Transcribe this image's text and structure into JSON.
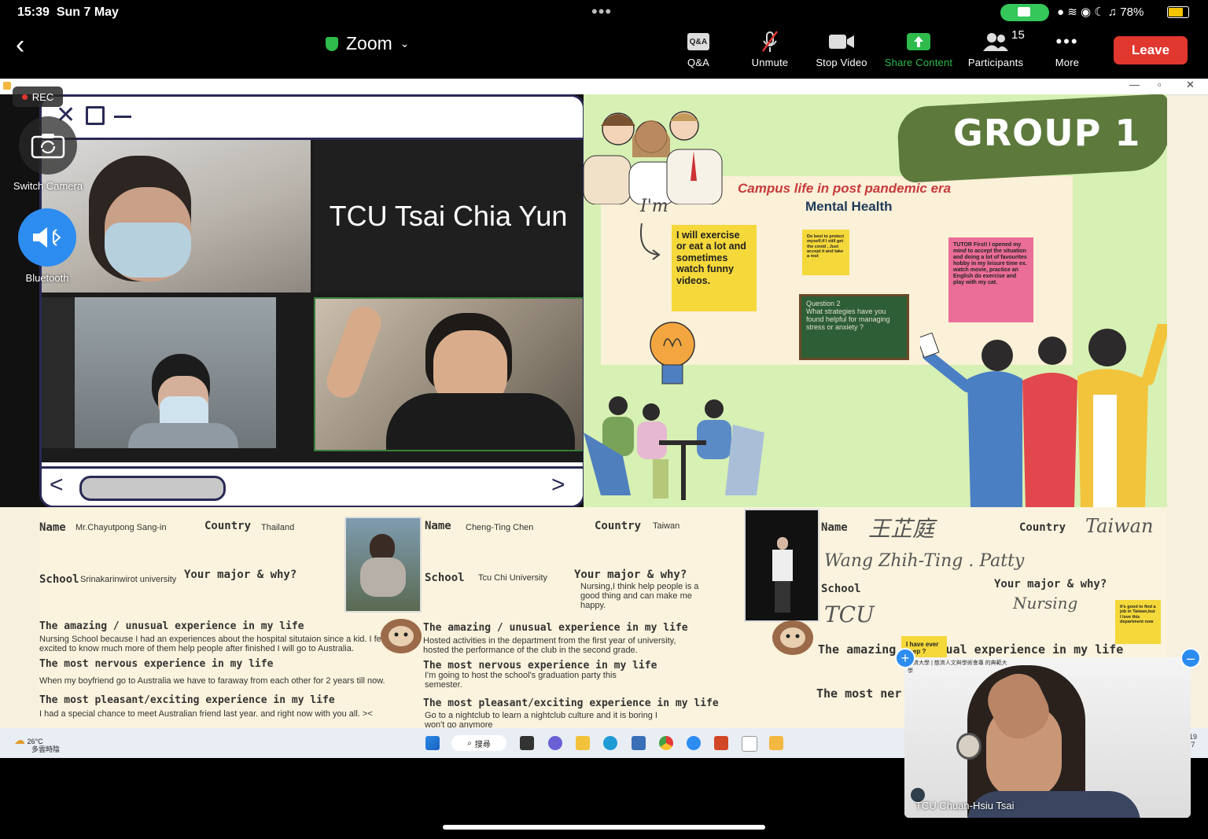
{
  "status_bar": {
    "time": "15:39",
    "date": "Sun 7 May",
    "battery": "78%"
  },
  "toolbar": {
    "app_title": "Zoom",
    "qa_badge": "Q&A",
    "qa_label": "Q&A",
    "unmute_label": "Unmute",
    "stop_video_label": "Stop Video",
    "share_content_label": "Share Content",
    "participants_label": "Participants",
    "participants_count": "15",
    "more_label": "More",
    "leave_label": "Leave"
  },
  "overlay": {
    "rec_label": "REC",
    "switch_camera_label": "Switch Camera",
    "bluetooth_label": "Bluetooth"
  },
  "shared_screen": {
    "video_name_tile": "TCU Tsai Chia Yun",
    "slide": {
      "group_title": "GROUP 1",
      "subtitle": "Campus life in post pandemic era",
      "topic": "Mental Health",
      "handwriting": "I'm",
      "sticky_yellow": "I will exercise or eat a lot and sometimes watch funny videos.",
      "sticky_small": "Do best to protect myself.if I still get the covid , Just accept it and take a rest",
      "sticky_pink": "TUTOR First! I opened my mind to accept the situation and doing a lot of favourites hobby in my leisure time ex. watch movie, practice an English do exercise and play with my cat.",
      "chalkboard": "Question 2\nWhat strategies have you found helpful for managing stress or anxiety ?"
    },
    "profile1": {
      "name_label": "Name",
      "name": "Mr.Chayutpong Sang-in",
      "country_label": "Country",
      "country": "Thailand",
      "school_label": "School",
      "school": "Srinakarinwirot university",
      "major_label": "Your major & why?",
      "amazing_label": "The amazing / unusual experience in my life",
      "amazing": "Nursing School because I had an experiences about the hospital situtaion since a kid. I feel excited to know much more of them help people after finished I will go to Australia.",
      "nervous_label": "The most nervous experience in my life",
      "nervous": "When my boyfriend go to Australia we have to faraway from each other for 2 years till now.",
      "pleasant_label": "The most pleasant/exciting experience in my life",
      "pleasant": "I had a special chance to meet Australian friend last year. and right now with you all. ><"
    },
    "profile2": {
      "name_label": "Name",
      "name": "Cheng-Ting Chen",
      "country_label": "Country",
      "country": "Taiwan",
      "school_label": "School",
      "school": "Tcu Chi University",
      "major_label": "Your major & why?",
      "major": "Nursing,I think help people is a good thing and can make me happy.",
      "amazing_label": "The amazing / unusual experience in my life",
      "amazing": "Hosted activities in the department from the first year of university, hosted the performance of the club in the second grade.",
      "nervous_label": "The most nervous experience in my life",
      "nervous": "I'm going to host the school's graduation party this semester.",
      "pleasant_label": "The most pleasant/exciting experience in my life",
      "pleasant": "Go to a nightclub to learn a nightclub culture and it is boring I won't go anymore"
    },
    "profile3": {
      "name_label": "Name",
      "name_hand": "王芷庭",
      "name_roman": "Wang Zhih-Ting . Patty",
      "country_label": "Country",
      "country_hand": "Taiwan",
      "school_label": "School",
      "school_hand": "TCU",
      "major_label": "Your major & why?",
      "major_hand": "Nursing",
      "amazing_label": "The amazing / unusual experience in my life",
      "nervous_label": "The most ner",
      "sticky_small1": "I have ever keep ?",
      "sticky_small2": "It's good to find a job in Taiwan,but I love this department now"
    },
    "taskbar": {
      "temp": "26°C",
      "weather": "多雲時陰",
      "search": "搜尋",
      "clock_top": "19",
      "clock_bottom": "/7"
    }
  },
  "pip": {
    "name": "TCU Chuan-Hsiu Tsai",
    "logo_text": "慈濟大學 | 慈濟人文與學術會專 的典範大學"
  },
  "colors": {
    "leave": "#e0372f",
    "share_green": "#2ebb4b",
    "slide_bg": "#d7f0b4",
    "accent_blue": "#2d8cf0"
  }
}
